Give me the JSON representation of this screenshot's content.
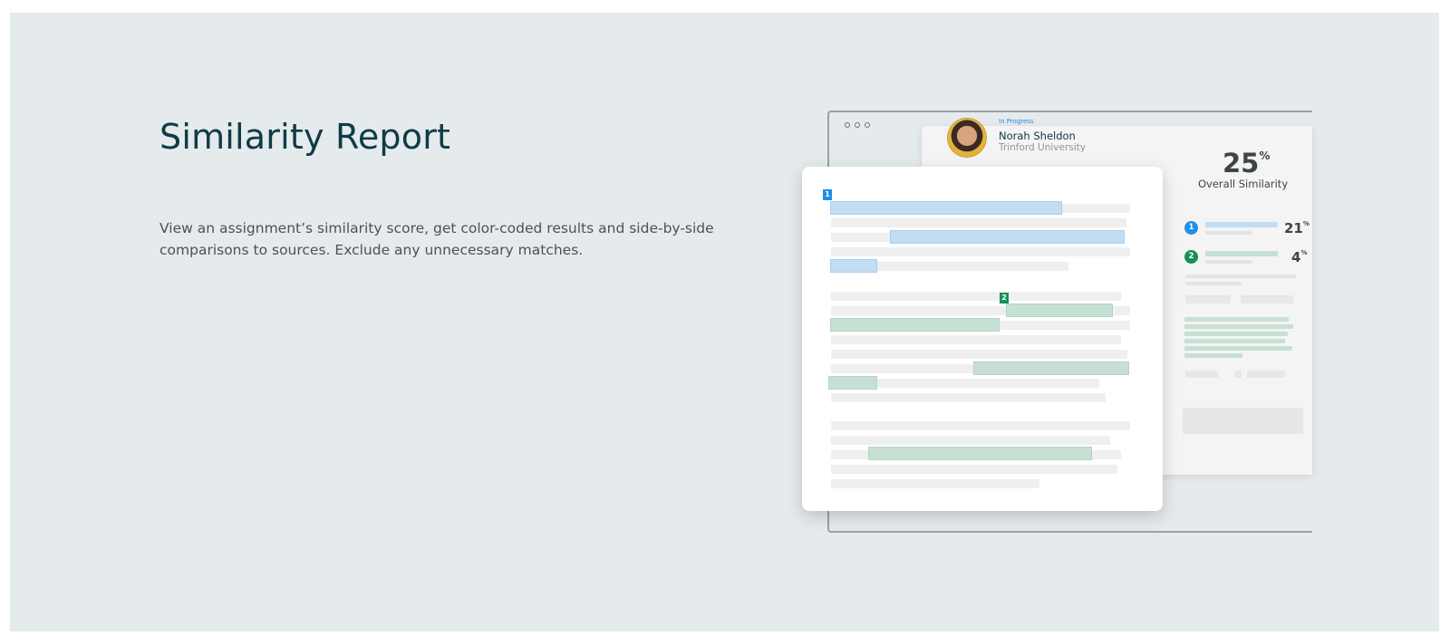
{
  "section": {
    "title": "Similarity Report",
    "description": "View an assignment’s similarity score, get color-coded results and side-by-side comparisons to sources. Exclude any unnecessary matches."
  },
  "illustration": {
    "status": "In Progress",
    "student_name": "Norah Sheldon",
    "institution": "Trinford University",
    "overall_percent": "25",
    "percent_sign": "%",
    "overall_label": "Overall Similarity",
    "sources": [
      {
        "number": "1",
        "percent": "21",
        "color": "#1e8fe8"
      },
      {
        "number": "2",
        "percent": "4",
        "color": "#14915a"
      }
    ],
    "match_markers": [
      "1",
      "2"
    ],
    "colors": {
      "background": "#e5eaec",
      "title": "#0f3b47",
      "match_blue": "#c3ddf3",
      "match_green": "#c7e0d4"
    }
  }
}
